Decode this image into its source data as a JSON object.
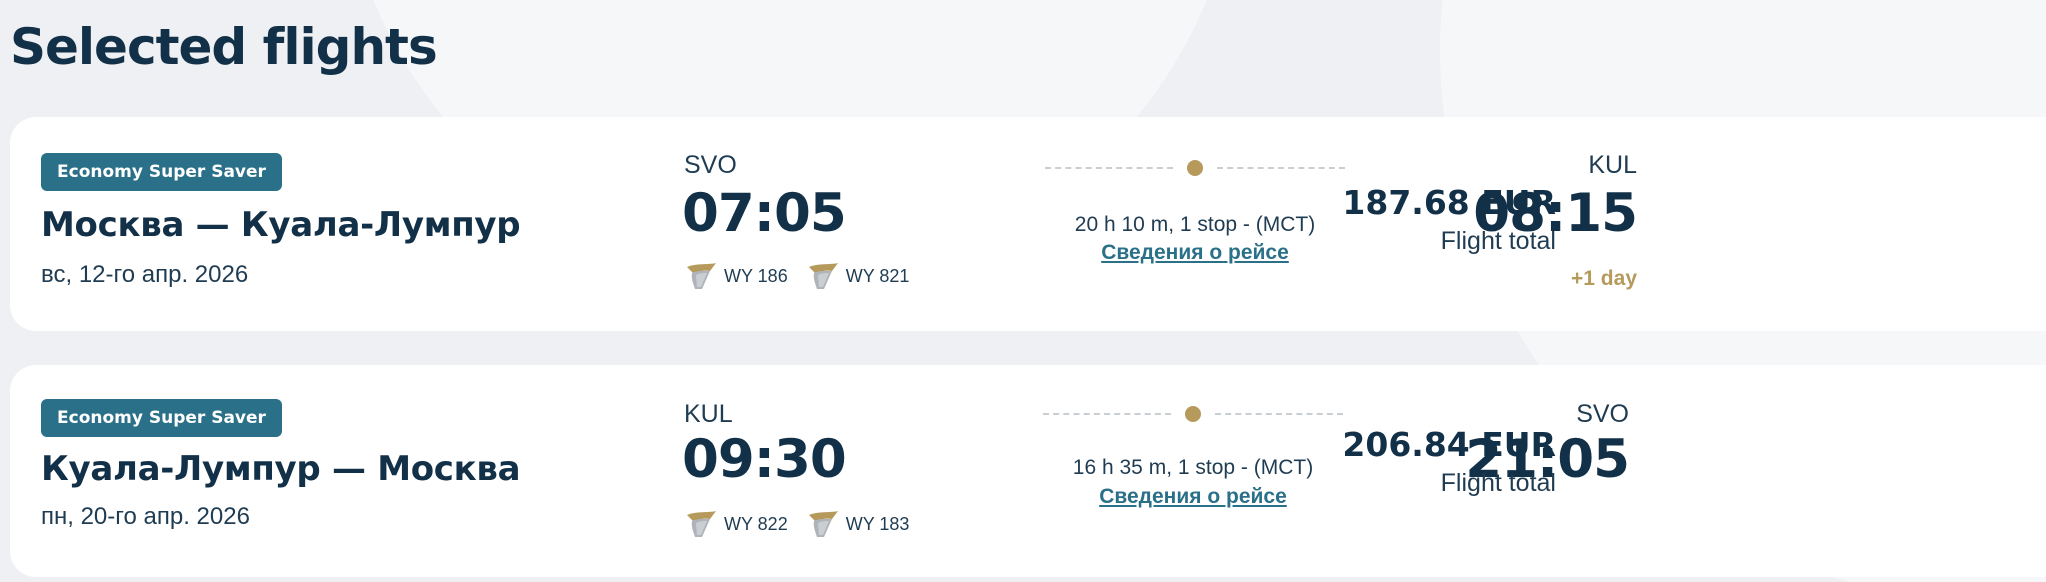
{
  "page": {
    "title": "Selected flights"
  },
  "colors": {
    "badge_bg": "#2b7089",
    "text_primary": "#123047",
    "link": "#2b7089",
    "accent_gold": "#b59a5c",
    "background": "#eef0f3"
  },
  "flights": [
    {
      "fare": "Economy Super Saver",
      "route": "Москва — Куала-Лумпур",
      "date": "вс, 12-го апр. 2026",
      "departure": {
        "code": "SVO",
        "time": "07:05"
      },
      "segments": [
        {
          "icon": "airline-tail-icon",
          "number": "WY 186"
        },
        {
          "icon": "airline-tail-icon",
          "number": "WY 821"
        }
      ],
      "duration": "20 h 10 m, 1 stop - (MCT)",
      "details_link": "Сведения о рейсе",
      "arrival": {
        "code": "KUL",
        "time": "08:15",
        "day_shift": "+1 day"
      },
      "price": "187.68 EUR",
      "price_label": "Flight total"
    },
    {
      "fare": "Economy Super Saver",
      "route": "Куала-Лумпур — Москва",
      "date": "пн, 20-го апр. 2026",
      "departure": {
        "code": "KUL",
        "time": "09:30"
      },
      "segments": [
        {
          "icon": "airline-tail-icon",
          "number": "WY 822"
        },
        {
          "icon": "airline-tail-icon",
          "number": "WY 183"
        }
      ],
      "duration": "16 h 35 m, 1 stop - (MCT)",
      "details_link": "Сведения о рейсе",
      "arrival": {
        "code": "SVO",
        "time": "21:05",
        "day_shift": ""
      },
      "price": "206.84 EUR",
      "price_label": "Flight total"
    }
  ]
}
